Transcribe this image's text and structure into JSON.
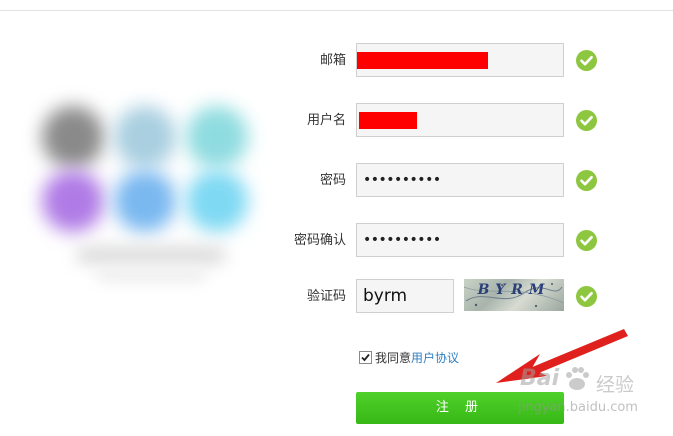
{
  "form": {
    "email": {
      "label": "邮箱"
    },
    "username": {
      "label": "用户名"
    },
    "password": {
      "label": "密码",
      "value": "••••••••••"
    },
    "password_confirm": {
      "label": "密码确认",
      "value": "••••••••••"
    },
    "captcha": {
      "label": "验证码",
      "value": "byrm",
      "image_text": "BYRM"
    },
    "agree": {
      "text": "我同意",
      "link": "用户协议",
      "checked": true
    },
    "submit_label": "注 册"
  },
  "watermark": {
    "brand": "Bai",
    "brand_cn": "经验",
    "sub": "jingyan.baidu.com"
  },
  "colors": {
    "check": "#8dc63f",
    "button": "#3cbc19",
    "redaction": "#ff0000",
    "link": "#2f7fc1",
    "arrow": "#e0201c"
  }
}
